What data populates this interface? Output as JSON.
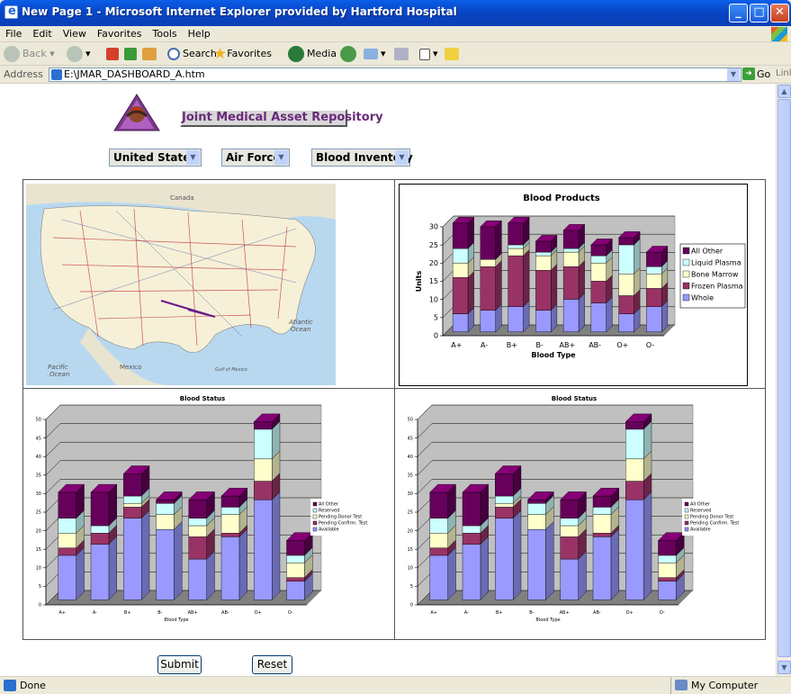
{
  "window": {
    "title": "New Page 1 - Microsoft Internet Explorer provided by Hartford Hospital",
    "min": "_",
    "max": "□",
    "close": "✕"
  },
  "menu": [
    "File",
    "Edit",
    "View",
    "Favorites",
    "Tools",
    "Help"
  ],
  "toolbar": {
    "back": "Back",
    "search": "Search",
    "favorites": "Favorites",
    "media": "Media"
  },
  "address": {
    "label": "Address",
    "value": "E:\\JMAR_DASHBOARD_A.htm",
    "go": "Go",
    "links": "Links"
  },
  "page": {
    "banner": "Joint Medical Asset Repository",
    "filters": [
      "United States",
      "Air Force",
      "Blood Inventory"
    ],
    "map": {
      "labels": {
        "canada": "Canada",
        "mexico": "Mexico",
        "atlantic": "Atlantic",
        "atlantic2": "Ocean",
        "pacific": "Pacific",
        "pacific2": "Ocean",
        "gulf": "Gulf of Mexico"
      }
    },
    "submit": "Submit",
    "reset": "Reset"
  },
  "status": {
    "left": "Done",
    "right": "My Computer"
  },
  "colors": {
    "allOther": "#66005a",
    "liquid": "#ccffff",
    "bone": "#ffffcc",
    "frozen": "#993366",
    "whole": "#9999ff",
    "plot": "#c0c0c0"
  },
  "chart_data": [
    {
      "type": "bar",
      "title": "Blood Products",
      "xlabel": "Blood Type",
      "ylabel": "Units",
      "categories": [
        "A+",
        "A-",
        "B+",
        "B-",
        "AB+",
        "AB-",
        "O+",
        "O-"
      ],
      "ylim": [
        0,
        30
      ],
      "yticks": [
        0,
        5,
        10,
        15,
        20,
        25,
        30
      ],
      "series": [
        {
          "name": "Whole",
          "color": "#9999ff",
          "values": [
            5,
            6,
            7,
            6,
            9,
            8,
            5,
            7
          ]
        },
        {
          "name": "Frozen Plasma",
          "color": "#993366",
          "values": [
            10,
            12,
            14,
            11,
            9,
            6,
            5,
            5
          ]
        },
        {
          "name": "Bone Marrow",
          "color": "#ffffcc",
          "values": [
            4,
            2,
            2,
            4,
            4,
            5,
            6,
            4
          ]
        },
        {
          "name": "Liquid Plasma",
          "color": "#ccffff",
          "values": [
            4,
            0,
            1,
            1,
            1,
            2,
            8,
            2
          ]
        },
        {
          "name": "All Other",
          "color": "#66005a",
          "values": [
            7,
            9,
            6,
            3,
            5,
            3,
            2,
            4
          ]
        }
      ],
      "legend": "right"
    },
    {
      "type": "bar",
      "title": "Blood Status",
      "xlabel": "Blood Type",
      "ylabel": "",
      "categories": [
        "A+",
        "A-",
        "B+",
        "B-",
        "AB+",
        "AB-",
        "O+",
        "O-"
      ],
      "ylim": [
        0,
        50
      ],
      "yticks": [
        0,
        5,
        10,
        15,
        20,
        25,
        30,
        35,
        40,
        45,
        50
      ],
      "series": [
        {
          "name": "Available",
          "color": "#9999ff",
          "values": [
            12,
            15,
            22,
            19,
            11,
            17,
            27,
            5
          ]
        },
        {
          "name": "Pending Confirm. Test",
          "color": "#993366",
          "values": [
            2,
            3,
            3,
            0,
            6,
            1,
            5,
            1
          ]
        },
        {
          "name": "Pending Donor Test",
          "color": "#ffffcc",
          "values": [
            4,
            0,
            1,
            4,
            3,
            5,
            6,
            4
          ]
        },
        {
          "name": "Reserved",
          "color": "#ccffff",
          "values": [
            4,
            2,
            2,
            3,
            2,
            2,
            8,
            2
          ]
        },
        {
          "name": "All Other",
          "color": "#66005a",
          "values": [
            7,
            9,
            6,
            1,
            5,
            3,
            2,
            4
          ]
        }
      ],
      "legend": "right"
    },
    {
      "type": "bar",
      "title": "Blood Status",
      "xlabel": "Blood Type",
      "ylabel": "",
      "categories": [
        "A+",
        "A-",
        "B+",
        "B-",
        "AB+",
        "AB-",
        "O+",
        "O-"
      ],
      "ylim": [
        0,
        50
      ],
      "yticks": [
        0,
        5,
        10,
        15,
        20,
        25,
        30,
        35,
        40,
        45,
        50
      ],
      "series": [
        {
          "name": "Available",
          "color": "#9999ff",
          "values": [
            12,
            15,
            22,
            19,
            11,
            17,
            27,
            5
          ]
        },
        {
          "name": "Pending Confirm. Test",
          "color": "#993366",
          "values": [
            2,
            3,
            3,
            0,
            6,
            1,
            5,
            1
          ]
        },
        {
          "name": "Pending Donor Test",
          "color": "#ffffcc",
          "values": [
            4,
            0,
            1,
            4,
            3,
            5,
            6,
            4
          ]
        },
        {
          "name": "Reserved",
          "color": "#ccffff",
          "values": [
            4,
            2,
            2,
            3,
            2,
            2,
            8,
            2
          ]
        },
        {
          "name": "All Other",
          "color": "#66005a",
          "values": [
            7,
            9,
            6,
            1,
            5,
            3,
            2,
            4
          ]
        }
      ],
      "legend": "right"
    }
  ]
}
